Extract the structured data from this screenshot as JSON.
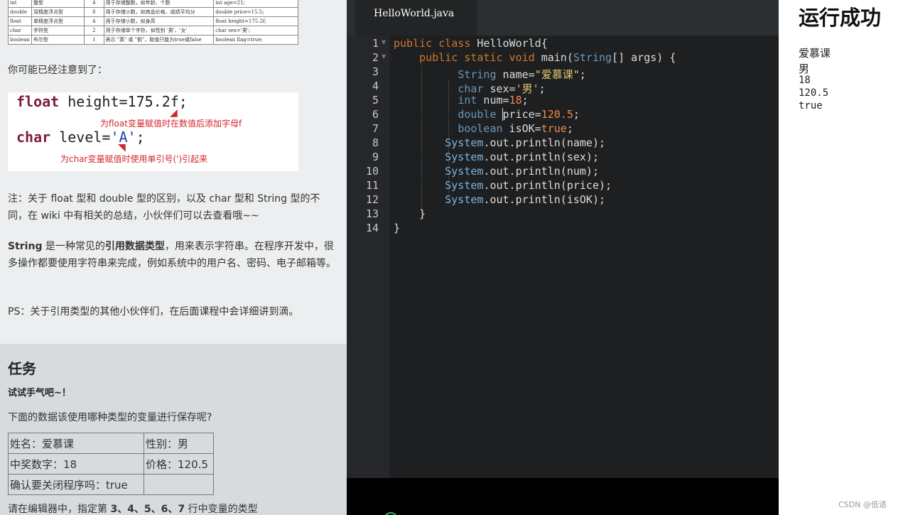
{
  "lesson": {
    "type_table": [
      [
        "int",
        "整型",
        "4",
        "用于存储整数，如年龄、个数",
        "int age=21;"
      ],
      [
        "double",
        "双精度浮点型",
        "8",
        "用于存储小数，如商品价格、成绩平均分",
        "double price=15.5;"
      ],
      [
        "float",
        "单精度浮点型",
        "4",
        "用于存储小数，如身高",
        "float height=175.2f;"
      ],
      [
        "char",
        "字符型",
        "2",
        "用于存储单个字符，如性别 '男'、'女'",
        "char sex='男';"
      ],
      [
        "boolean",
        "布尔型",
        "1",
        "表示 \"真\" 或 \"假\"，取值只能为true或false",
        "boolean flag=true;"
      ]
    ],
    "notice": "你可能已经注意到了：",
    "snippet": {
      "line1_kw": "float",
      "line1_rest": " height=175.2f;",
      "line1_note": "为float变量赋值时在数值后添加字母f",
      "line2_kw": "char",
      "line2_mid": " level=",
      "line2_str": "'A'",
      "line2_end": ";",
      "line2_note": "为char变量赋值时使用单引号(')引起来"
    },
    "note_paragraph": "注：关于 float 型和 double 型的区别，以及 char 型和 String 型的不同，在 wiki 中有相关的总结，小伙伴们可以去查看哦~~",
    "string_bold": "String",
    "string_mid": " 是一种常见的",
    "string_bold2": "引用数据类型",
    "string_rest": "，用来表示字符串。在程序开发中，很多操作都要使用字符串来完成，例如系统中的用户名、密码、电子邮箱等。",
    "ps": "PS：关于引用类型的其他小伙伴们，在后面课程中会详细讲到滴。"
  },
  "task": {
    "title": "任务",
    "subtitle": "试试手气吧~！",
    "question": "下面的数据该使用哪种类型的变量进行保存呢?",
    "table": [
      [
        "姓名：爱慕课",
        "性别：男"
      ],
      [
        "中奖数字：18",
        "价格：120.5"
      ],
      [
        "确认要关闭程序吗：true",
        ""
      ]
    ],
    "bottom_a": "请在编辑器中，指定第 ",
    "bottom_b": "3、4、5、6、7",
    "bottom_c": " 行中变量的类型"
  },
  "editor": {
    "tab_label": "HelloWorld.java",
    "line_numbers": [
      "1",
      "2",
      "3",
      "4",
      "5",
      "6",
      "7",
      "8",
      "9",
      "10",
      "11",
      "12",
      "13",
      "14"
    ]
  },
  "output": {
    "title": "运行成功",
    "lines": [
      "爱慕课",
      "男",
      "18",
      "120.5",
      "true"
    ]
  },
  "watermark": "CSDN @低语"
}
